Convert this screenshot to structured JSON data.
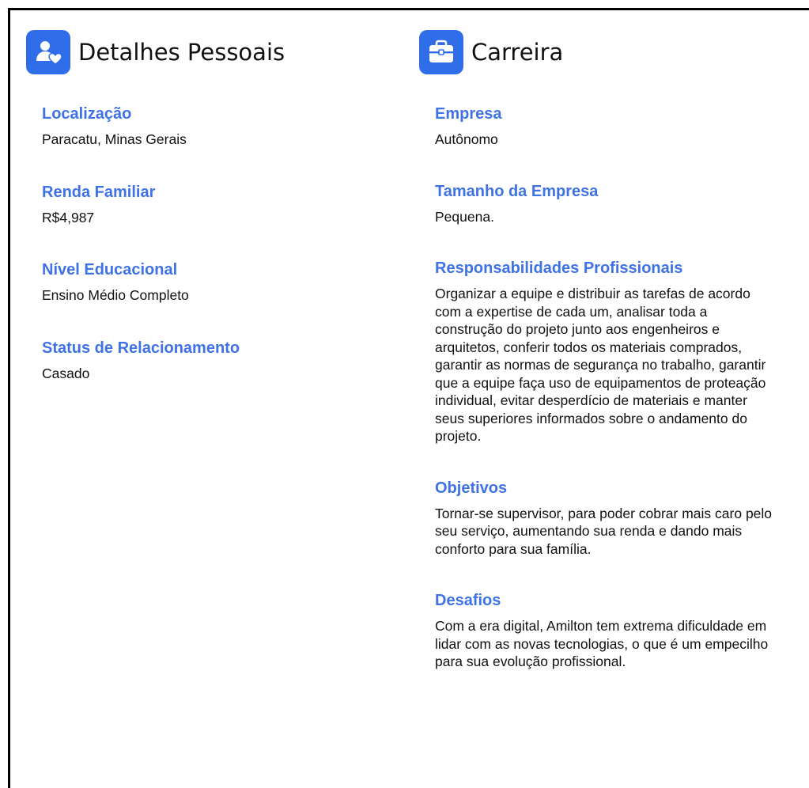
{
  "personal": {
    "title": "Detalhes Pessoais",
    "icon": "user-heart-icon",
    "fields": [
      {
        "label": "Localização",
        "value": "Paracatu, Minas Gerais"
      },
      {
        "label": "Renda Familiar",
        "value": "R$4,987"
      },
      {
        "label": "Nível Educacional",
        "value": "Ensino Médio Completo"
      },
      {
        "label": "Status de Relacionamento",
        "value": "Casado"
      }
    ]
  },
  "career": {
    "title": "Carreira",
    "icon": "briefcase-icon",
    "fields": [
      {
        "label": "Empresa",
        "value": "Autônomo"
      },
      {
        "label": "Tamanho da Empresa",
        "value": "Pequena."
      },
      {
        "label": "Responsabilidades Profissionais",
        "value": "Organizar a equipe e distribuir as tarefas de acordo com a expertise de cada um, analisar toda a construção do projeto junto aos engenheiros e arquitetos, conferir todos os materiais comprados, garantir as normas de segurança no trabalho, garantir que a equipe faça uso de equipamentos de proteação individual, evitar desperdício de materiais e manter seus superiores informados sobre o andamento do projeto."
      },
      {
        "label": "Objetivos",
        "value": "Tornar-se supervisor, para poder cobrar mais caro pelo seu serviço, aumentando sua renda e dando mais conforto para sua família."
      },
      {
        "label": "Desafios",
        "value": "Com a era digital, Amilton tem extrema dificuldade em lidar com as novas tecnologias, o que é um empecilho para sua evolução profissional."
      }
    ]
  },
  "colors": {
    "accent": "#3f72e6",
    "icon_bg": "#2f6ee8",
    "text": "#111111"
  }
}
